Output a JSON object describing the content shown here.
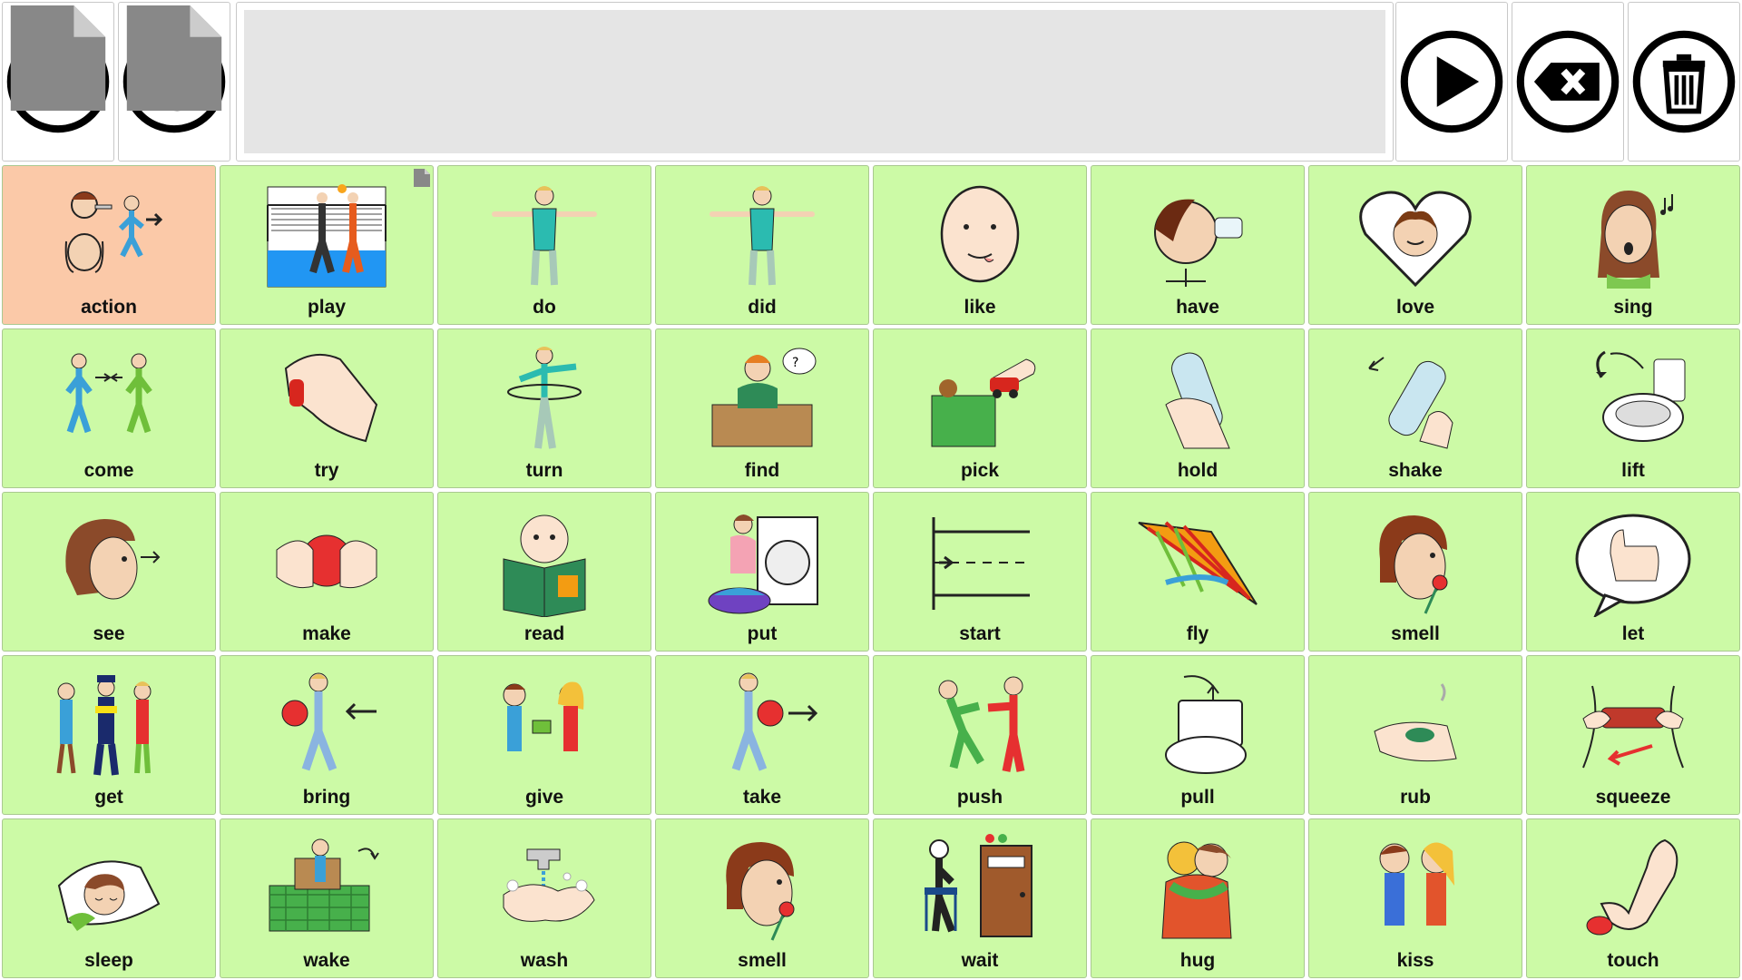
{
  "toolbar": {
    "left_buttons": [
      {
        "name": "home-button",
        "icon": "home-icon"
      },
      {
        "name": "back-button",
        "icon": "undo-icon"
      }
    ],
    "sentence_text": "",
    "right_buttons": [
      {
        "name": "speak-button",
        "icon": "play-icon"
      },
      {
        "name": "backspace-button",
        "icon": "backspace-icon"
      },
      {
        "name": "clear-button",
        "icon": "trash-icon"
      }
    ]
  },
  "colors": {
    "cell_bg": "#ccfaa6",
    "category_bg": "#fbc9a8",
    "sentence_bg": "#e5e5e5"
  },
  "cells": [
    {
      "label": "action",
      "icon": "action-icon",
      "category": true
    },
    {
      "label": "play",
      "icon": "play-volleyball-icon",
      "folder": true
    },
    {
      "label": "do",
      "icon": "do-icon"
    },
    {
      "label": "did",
      "icon": "did-icon"
    },
    {
      "label": "like",
      "icon": "like-icon"
    },
    {
      "label": "have",
      "icon": "have-icon"
    },
    {
      "label": "love",
      "icon": "love-icon"
    },
    {
      "label": "sing",
      "icon": "sing-icon"
    },
    {
      "label": "come",
      "icon": "come-icon"
    },
    {
      "label": "try",
      "icon": "try-icon"
    },
    {
      "label": "turn",
      "icon": "turn-icon"
    },
    {
      "label": "find",
      "icon": "find-icon"
    },
    {
      "label": "pick",
      "icon": "pick-icon"
    },
    {
      "label": "hold",
      "icon": "hold-icon"
    },
    {
      "label": "shake",
      "icon": "shake-icon"
    },
    {
      "label": "lift",
      "icon": "lift-icon"
    },
    {
      "label": "see",
      "icon": "see-icon"
    },
    {
      "label": "make",
      "icon": "make-icon"
    },
    {
      "label": "read",
      "icon": "read-icon"
    },
    {
      "label": "put",
      "icon": "put-icon"
    },
    {
      "label": "start",
      "icon": "start-icon"
    },
    {
      "label": "fly",
      "icon": "fly-icon"
    },
    {
      "label": "smell",
      "icon": "smell-icon"
    },
    {
      "label": "let",
      "icon": "let-icon"
    },
    {
      "label": "get",
      "icon": "get-icon"
    },
    {
      "label": "bring",
      "icon": "bring-icon"
    },
    {
      "label": "give",
      "icon": "give-icon"
    },
    {
      "label": "take",
      "icon": "take-icon"
    },
    {
      "label": "push",
      "icon": "push-icon"
    },
    {
      "label": "pull",
      "icon": "pull-icon"
    },
    {
      "label": "rub",
      "icon": "rub-icon"
    },
    {
      "label": "squeeze",
      "icon": "squeeze-icon"
    },
    {
      "label": "sleep",
      "icon": "sleep-icon"
    },
    {
      "label": "wake",
      "icon": "wake-icon"
    },
    {
      "label": "wash",
      "icon": "wash-icon"
    },
    {
      "label": "smell",
      "icon": "smell-icon"
    },
    {
      "label": "wait",
      "icon": "wait-icon"
    },
    {
      "label": "hug",
      "icon": "hug-icon"
    },
    {
      "label": "kiss",
      "icon": "kiss-icon"
    },
    {
      "label": "touch",
      "icon": "touch-icon"
    }
  ]
}
